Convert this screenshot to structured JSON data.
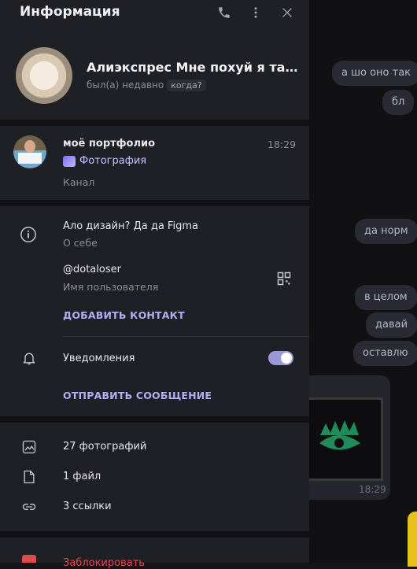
{
  "header": {
    "title": "Информация"
  },
  "profile": {
    "name": "Алиэкспрес Мне похуй я так чувствую",
    "status": "был(а) недавно",
    "when": "когда?"
  },
  "channel": {
    "name": "моё портфолио",
    "time": "18:29",
    "tag": "Фотография",
    "kind": "Канал"
  },
  "about": {
    "value": "Ало дизайн? Да да Figma",
    "label": "О себе"
  },
  "username": {
    "value": "@dotaloser",
    "label": "Имя пользователя"
  },
  "actions": {
    "add_contact": "ДОБАВИТЬ КОНТАКТ",
    "send_message": "ОТПРАВИТЬ СООБЩЕНИЕ"
  },
  "notifications": {
    "label": "Уведомления",
    "enabled": true
  },
  "media": {
    "photos": "27 фотографий",
    "files": "1 файл",
    "links": "3 ссылки"
  },
  "danger": {
    "block": "Заблокировать"
  },
  "chat": {
    "messages": [
      "а шо оно так",
      "бл",
      "да норм",
      "в целом",
      "давай",
      "оставлю"
    ],
    "media_time": "18:29"
  },
  "colors": {
    "accent": "#b3aef5",
    "panel": "#1f1f26",
    "danger": "#e04a4a"
  }
}
